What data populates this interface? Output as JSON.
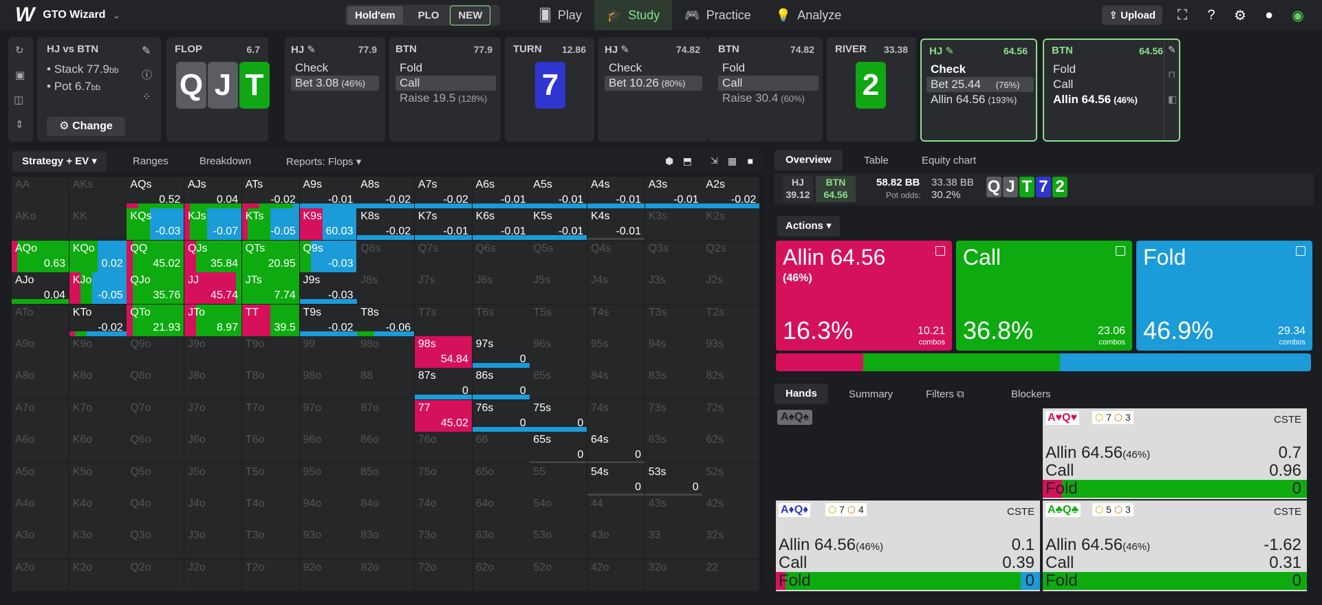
{
  "nav": {
    "logo": "W",
    "app_title": "GTO Wizard",
    "game_holdem": "Hold'em",
    "game_plo": "PLO",
    "new_badge": "NEW",
    "play": "Play",
    "study": "Study",
    "practice": "Practice",
    "analyze": "Analyze",
    "upload": "Upload"
  },
  "spot": {
    "title": "HJ vs BTN",
    "stack_label": "Stack 77.9",
    "stack_unit": "bb",
    "pot_label": "Pot 6.7",
    "pot_unit": "bb",
    "change": "Change"
  },
  "flop": {
    "label": "FLOP",
    "pot": "6.7",
    "cards": [
      "Q",
      "J",
      "T"
    ]
  },
  "hj1": {
    "label": "HJ",
    "pot": "77.9",
    "a1": "Check",
    "a2": "Bet 3.08",
    "a2p": "(46%)"
  },
  "btn1": {
    "label": "BTN",
    "pot": "77.9",
    "a1": "Fold",
    "a2": "Call",
    "a3": "Raise 19.5",
    "a3p": "(128%)"
  },
  "turn": {
    "label": "TURN",
    "pot": "12.86",
    "card": "7"
  },
  "hj2": {
    "label": "HJ",
    "pot": "74.82",
    "a1": "Check",
    "a2": "Bet 10.26",
    "a2p": "(80%)"
  },
  "btn2": {
    "label": "BTN",
    "pot": "74.82",
    "a1": "Fold",
    "a2": "Call",
    "a3": "Raise 30.4",
    "a3p": "(60%)"
  },
  "river": {
    "label": "RIVER",
    "pot": "33.38",
    "card": "2"
  },
  "hj3": {
    "label": "HJ",
    "pot": "64.56",
    "a1": "Check",
    "a2": "Bet 25.44",
    "a2p": "(76%)",
    "a3": "Allin 64.56",
    "a3p": "(193%)"
  },
  "btn3": {
    "label": "BTN",
    "pot": "64.56",
    "a1": "Fold",
    "a2": "Call",
    "a3": "Allin 64.56",
    "a3p": "(46%)"
  },
  "tabs": {
    "strategy": "Strategy + EV",
    "ranges": "Ranges",
    "breakdown": "Breakdown",
    "reports": "Reports: Flops"
  },
  "grid": [
    [
      "AA",
      "",
      0,
      0,
      0
    ],
    [
      "AKs",
      "",
      0,
      0,
      0
    ],
    [
      "AQs",
      "0.52",
      0.2,
      0.8,
      0
    ],
    [
      "AJs",
      "0.04",
      0.1,
      0.9,
      0
    ],
    [
      "ATs",
      "-0.02",
      0.3,
      0.6,
      0.1
    ],
    [
      "A9s",
      "-0.01",
      0,
      0,
      1
    ],
    [
      "A8s",
      "-0.02",
      0,
      0,
      1
    ],
    [
      "A7s",
      "-0.02",
      0,
      0,
      1
    ],
    [
      "A6s",
      "-0.01",
      0,
      0,
      1
    ],
    [
      "A5s",
      "-0.01",
      0,
      0,
      1
    ],
    [
      "A4s",
      "-0.01",
      0,
      0,
      1
    ],
    [
      "A3s",
      "-0.01",
      0,
      0,
      1
    ],
    [
      "A2s",
      "-0.02",
      0,
      0,
      1
    ],
    [
      "AKo",
      "",
      0,
      0,
      0
    ],
    [
      "KK",
      "",
      0,
      0,
      0
    ],
    [
      "KQs",
      "-0.03",
      0,
      0.4,
      0.6
    ],
    [
      "KJs",
      "-0.07",
      0.1,
      0.3,
      0.6
    ],
    [
      "KTs",
      "-0.05",
      0.1,
      0.4,
      0.5
    ],
    [
      "K9s",
      "60.03",
      0.4,
      0,
      0.6
    ],
    [
      "K8s",
      "-0.02",
      0,
      0,
      1
    ],
    [
      "K7s",
      "-0.01",
      0,
      0,
      1
    ],
    [
      "K6s",
      "-0.01",
      0,
      0,
      1
    ],
    [
      "K5s",
      "-0.01",
      0,
      0,
      1
    ],
    [
      "K4s",
      "-0.01",
      0,
      0,
      0
    ],
    [
      "K3s",
      "",
      0,
      0,
      0
    ],
    [
      "K2s",
      "",
      0,
      0,
      0
    ],
    [
      "AQo",
      "0.63",
      0.1,
      0.9,
      0
    ],
    [
      "KQo",
      "0.02",
      0,
      0.5,
      0.5
    ],
    [
      "QQ",
      "45.02",
      0.1,
      0.9,
      0
    ],
    [
      "QJs",
      "35.84",
      0.2,
      0.8,
      0
    ],
    [
      "QTs",
      "20.95",
      0,
      1,
      0
    ],
    [
      "Q9s",
      "-0.03",
      0,
      0.2,
      0.8
    ],
    [
      "Q8s",
      "",
      0,
      0,
      0
    ],
    [
      "Q7s",
      "",
      0,
      0,
      0
    ],
    [
      "Q6s",
      "",
      0,
      0,
      0
    ],
    [
      "Q5s",
      "",
      0,
      0,
      0
    ],
    [
      "Q4s",
      "",
      0,
      0,
      0
    ],
    [
      "Q3s",
      "",
      0,
      0,
      0
    ],
    [
      "Q2s",
      "",
      0,
      0,
      0
    ],
    [
      "AJo",
      "0.04",
      0,
      1,
      0
    ],
    [
      "KJo",
      "-0.05",
      0.2,
      0.2,
      0.6
    ],
    [
      "QJo",
      "35.76",
      0.1,
      0.9,
      0
    ],
    [
      "JJ",
      "45.74",
      0.9,
      0.1,
      0
    ],
    [
      "JTs",
      "7.74",
      0,
      1,
      0
    ],
    [
      "J9s",
      "-0.03",
      0,
      0,
      1
    ],
    [
      "J8s",
      "",
      0,
      0,
      0
    ],
    [
      "J7s",
      "",
      0,
      0,
      0
    ],
    [
      "J6s",
      "",
      0,
      0,
      0
    ],
    [
      "J5s",
      "",
      0,
      0,
      0
    ],
    [
      "J4s",
      "",
      0,
      0,
      0
    ],
    [
      "J3s",
      "",
      0,
      0,
      0
    ],
    [
      "J2s",
      "",
      0,
      0,
      0
    ],
    [
      "ATo",
      "",
      0,
      0,
      0
    ],
    [
      "KTo",
      "-0.02",
      0.1,
      0.2,
      0.7
    ],
    [
      "QTo",
      "21.93",
      0.1,
      0.9,
      0
    ],
    [
      "JTo",
      "8.97",
      0.2,
      0.8,
      0
    ],
    [
      "TT",
      "39.5",
      0.5,
      0.5,
      0
    ],
    [
      "T9s",
      "-0.02",
      0,
      0,
      1
    ],
    [
      "T8s",
      "-0.06",
      0,
      0.3,
      0.7
    ],
    [
      "T7s",
      "",
      0,
      0,
      0
    ],
    [
      "T6s",
      "",
      0,
      0,
      0
    ],
    [
      "T5s",
      "",
      0,
      0,
      0
    ],
    [
      "T4s",
      "",
      0,
      0,
      0
    ],
    [
      "T3s",
      "",
      0,
      0,
      0
    ],
    [
      "T2s",
      "",
      0,
      0,
      0
    ],
    [
      "A9o",
      "",
      0,
      0,
      0
    ],
    [
      "K9o",
      "",
      0,
      0,
      0
    ],
    [
      "Q9o",
      "",
      0,
      0,
      0
    ],
    [
      "J9o",
      "",
      0,
      0,
      0
    ],
    [
      "T9o",
      "",
      0,
      0,
      0
    ],
    [
      "99",
      "",
      0,
      0,
      0
    ],
    [
      "98o",
      "",
      0,
      0,
      0
    ],
    [
      "98s",
      "54.84",
      1,
      0,
      0
    ],
    [
      "97s",
      "0",
      0,
      0,
      1
    ],
    [
      "96s",
      "",
      0,
      0,
      0
    ],
    [
      "95s",
      "",
      0,
      0,
      0
    ],
    [
      "94s",
      "",
      0,
      0,
      0
    ],
    [
      "93s",
      "",
      0,
      0,
      0
    ],
    [
      "A8o",
      "",
      0,
      0,
      0
    ],
    [
      "K8o",
      "",
      0,
      0,
      0
    ],
    [
      "Q8o",
      "",
      0,
      0,
      0
    ],
    [
      "J8o",
      "",
      0,
      0,
      0
    ],
    [
      "T8o",
      "",
      0,
      0,
      0
    ],
    [
      "98o",
      "",
      0,
      0,
      0
    ],
    [
      "88",
      "",
      0,
      0,
      0
    ],
    [
      "87s",
      "0",
      0,
      0,
      1
    ],
    [
      "86s",
      "0",
      0,
      0,
      1
    ],
    [
      "85s",
      "",
      0,
      0,
      0
    ],
    [
      "84s",
      "",
      0,
      0,
      0
    ],
    [
      "83s",
      "",
      0,
      0,
      0
    ],
    [
      "82s",
      "",
      0,
      0,
      0
    ],
    [
      "A7o",
      "",
      0,
      0,
      0
    ],
    [
      "K7o",
      "",
      0,
      0,
      0
    ],
    [
      "Q7o",
      "",
      0,
      0,
      0
    ],
    [
      "J7o",
      "",
      0,
      0,
      0
    ],
    [
      "T7o",
      "",
      0,
      0,
      0
    ],
    [
      "97o",
      "",
      0,
      0,
      0
    ],
    [
      "87o",
      "",
      0,
      0,
      0
    ],
    [
      "77",
      "45.02",
      1,
      0,
      0
    ],
    [
      "76s",
      "0",
      0,
      0,
      1
    ],
    [
      "75s",
      "0",
      0,
      0,
      1
    ],
    [
      "74s",
      "",
      0,
      0,
      0
    ],
    [
      "73s",
      "",
      0,
      0,
      0
    ],
    [
      "72s",
      "",
      0,
      0,
      0
    ],
    [
      "A6o",
      "",
      0,
      0,
      0
    ],
    [
      "K6o",
      "",
      0,
      0,
      0
    ],
    [
      "Q6o",
      "",
      0,
      0,
      0
    ],
    [
      "J6o",
      "",
      0,
      0,
      0
    ],
    [
      "T6o",
      "",
      0,
      0,
      0
    ],
    [
      "96o",
      "",
      0,
      0,
      0
    ],
    [
      "86o",
      "",
      0,
      0,
      0
    ],
    [
      "76o",
      "",
      0,
      0,
      0
    ],
    [
      "66",
      "",
      0,
      0,
      0
    ],
    [
      "65s",
      "0",
      0,
      0,
      0
    ],
    [
      "64s",
      "0",
      0,
      0,
      0
    ],
    [
      "63s",
      "",
      0,
      0,
      0
    ],
    [
      "62s",
      "",
      0,
      0,
      0
    ],
    [
      "A5o",
      "",
      0,
      0,
      0
    ],
    [
      "K5o",
      "",
      0,
      0,
      0
    ],
    [
      "Q5o",
      "",
      0,
      0,
      0
    ],
    [
      "J5o",
      "",
      0,
      0,
      0
    ],
    [
      "T5o",
      "",
      0,
      0,
      0
    ],
    [
      "95o",
      "",
      0,
      0,
      0
    ],
    [
      "85o",
      "",
      0,
      0,
      0
    ],
    [
      "75o",
      "",
      0,
      0,
      0
    ],
    [
      "65o",
      "",
      0,
      0,
      0
    ],
    [
      "55",
      "",
      0,
      0,
      0
    ],
    [
      "54s",
      "0",
      0,
      0,
      0
    ],
    [
      "53s",
      "0",
      0,
      0,
      0
    ],
    [
      "52s",
      "",
      0,
      0,
      0
    ],
    [
      "A4o",
      "",
      0,
      0,
      0
    ],
    [
      "K4o",
      "",
      0,
      0,
      0
    ],
    [
      "Q4o",
      "",
      0,
      0,
      0
    ],
    [
      "J4o",
      "",
      0,
      0,
      0
    ],
    [
      "T4o",
      "",
      0,
      0,
      0
    ],
    [
      "94o",
      "",
      0,
      0,
      0
    ],
    [
      "84o",
      "",
      0,
      0,
      0
    ],
    [
      "74o",
      "",
      0,
      0,
      0
    ],
    [
      "64o",
      "",
      0,
      0,
      0
    ],
    [
      "54o",
      "",
      0,
      0,
      0
    ],
    [
      "44",
      "",
      0,
      0,
      0
    ],
    [
      "43s",
      "",
      0,
      0,
      0
    ],
    [
      "42s",
      "",
      0,
      0,
      0
    ],
    [
      "A3o",
      "",
      0,
      0,
      0
    ],
    [
      "K3o",
      "",
      0,
      0,
      0
    ],
    [
      "Q3o",
      "",
      0,
      0,
      0
    ],
    [
      "J3o",
      "",
      0,
      0,
      0
    ],
    [
      "T3o",
      "",
      0,
      0,
      0
    ],
    [
      "93o",
      "",
      0,
      0,
      0
    ],
    [
      "83o",
      "",
      0,
      0,
      0
    ],
    [
      "73o",
      "",
      0,
      0,
      0
    ],
    [
      "63o",
      "",
      0,
      0,
      0
    ],
    [
      "53o",
      "",
      0,
      0,
      0
    ],
    [
      "43o",
      "",
      0,
      0,
      0
    ],
    [
      "33",
      "",
      0,
      0,
      0
    ],
    [
      "32s",
      "",
      0,
      0,
      0
    ],
    [
      "A2o",
      "",
      0,
      0,
      0
    ],
    [
      "K2o",
      "",
      0,
      0,
      0
    ],
    [
      "Q2o",
      "",
      0,
      0,
      0
    ],
    [
      "J2o",
      "",
      0,
      0,
      0
    ],
    [
      "T2o",
      "",
      0,
      0,
      0
    ],
    [
      "92o",
      "",
      0,
      0,
      0
    ],
    [
      "82o",
      "",
      0,
      0,
      0
    ],
    [
      "72o",
      "",
      0,
      0,
      0
    ],
    [
      "62o",
      "",
      0,
      0,
      0
    ],
    [
      "52o",
      "",
      0,
      0,
      0
    ],
    [
      "42o",
      "",
      0,
      0,
      0
    ],
    [
      "32o",
      "",
      0,
      0,
      0
    ],
    [
      "22",
      "",
      0,
      0,
      0
    ]
  ],
  "right": {
    "overview": "Overview",
    "table": "Table",
    "equity": "Equity chart",
    "hj": "HJ",
    "hj_v": "39.12",
    "btn": "BTN",
    "btn_v": "64.56",
    "pot": "58.82 BB",
    "pot2": "33.38 BB",
    "odds_lbl": "Pot odds:",
    "odds": "30.2%",
    "board": [
      "Q",
      "J",
      "T",
      "7",
      "2"
    ],
    "actions": "Actions"
  },
  "cards": [
    {
      "t": "Allin 64.56",
      "s": "(46%)",
      "p": "16.3%",
      "c": "10.21",
      "cl": "combos",
      "color": "#d6115b"
    },
    {
      "t": "Call",
      "s": "",
      "p": "36.8%",
      "c": "23.06",
      "cl": "combos",
      "color": "#0eab10"
    },
    {
      "t": "Fold",
      "s": "",
      "p": "46.9%",
      "c": "29.34",
      "cl": "combos",
      "color": "#1b9bd8"
    }
  ],
  "freq": [
    16.3,
    36.8,
    46.9
  ],
  "htabs": {
    "hands": "Hands",
    "summary": "Summary",
    "filters": "Filters",
    "blockers": "Blockers"
  },
  "hands": {
    "sel": "A♠Q♠",
    "h1": {
      "hand": "A♥Q♥",
      "b1": "7",
      "b2": "3",
      "tag": "CSTE",
      "r1": "Allin 64.56",
      "r1p": "(46%)",
      "r1v": "0.7",
      "r2": "Call",
      "r2v": "0.96",
      "r3": "Fold",
      "r3v": "0"
    },
    "h2": {
      "hand": "A♦Q♦",
      "b1": "7",
      "b2": "4",
      "tag": "CSTE",
      "r1": "Allin 64.56",
      "r1p": "(46%)",
      "r1v": "0.1",
      "r2": "Call",
      "r2v": "0.39",
      "r3": "Fold",
      "r3v": "0"
    },
    "h3": {
      "hand": "A♣Q♣",
      "b1": "5",
      "b2": "3",
      "tag": "CSTE",
      "r1": "Allin 64.56",
      "r1p": "(46%)",
      "r1v": "-1.62",
      "r2": "Call",
      "r2v": "0.31",
      "r3": "Fold",
      "r3v": "0"
    }
  }
}
